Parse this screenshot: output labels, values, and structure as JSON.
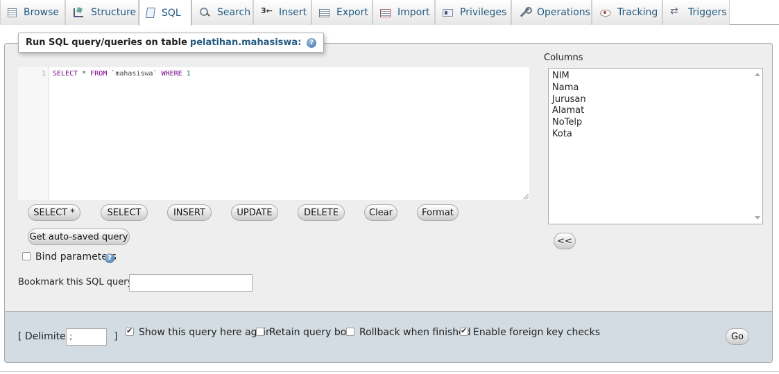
{
  "tabs": [
    {
      "label": "Browse",
      "icon": "browse-icon"
    },
    {
      "label": "Structure",
      "icon": "structure-icon"
    },
    {
      "label": "SQL",
      "icon": "sql-icon",
      "active": true
    },
    {
      "label": "Search",
      "icon": "search-icon"
    },
    {
      "label": "Insert",
      "icon": "insert-icon"
    },
    {
      "label": "Export",
      "icon": "export-icon"
    },
    {
      "label": "Import",
      "icon": "import-icon"
    },
    {
      "label": "Privileges",
      "icon": "privileges-icon"
    },
    {
      "label": "Operations",
      "icon": "operations-icon"
    },
    {
      "label": "Tracking",
      "icon": "tracking-icon"
    },
    {
      "label": "Triggers",
      "icon": "triggers-icon"
    }
  ],
  "legend": {
    "prefix": "Run SQL query/queries on table",
    "table": "pelatihan.mahasiswa:",
    "help_glyph": "?"
  },
  "editor": {
    "line_number": "1",
    "tokens": {
      "select": "SELECT",
      "star": " * ",
      "from": "FROM",
      "table": " `mahasiswa` ",
      "where": "WHERE",
      "space": " ",
      "one": "1"
    }
  },
  "buttons": {
    "select_star": "SELECT *",
    "select": "SELECT",
    "insert": "INSERT",
    "update": "UPDATE",
    "delete": "DELETE",
    "clear": "Clear",
    "format": "Format",
    "get_autosaved": "Get auto-saved query",
    "insert_column": "<<",
    "go": "Go"
  },
  "bind_parameters": {
    "label": "Bind parameters",
    "checked": false
  },
  "bookmark": {
    "label": "Bookmark this SQL query:",
    "value": ""
  },
  "columns": {
    "title": "Columns",
    "items": [
      "NIM",
      "Nama",
      "Jurusan",
      "Alamat",
      "NoTelp",
      "Kota"
    ]
  },
  "footer": {
    "delimiter_open": "[ Delimiter",
    "delimiter_value": ";",
    "delimiter_close": "]",
    "show_query_again": {
      "label": "Show this query here again",
      "checked": true
    },
    "retain_query_box": {
      "label": "Retain query box",
      "checked": false
    },
    "rollback": {
      "label": "Rollback when finished",
      "checked": false
    },
    "foreign_key_checks": {
      "label": "Enable foreign key checks",
      "checked": true
    }
  },
  "colors": {
    "link": "#235a81",
    "panel_bg": "#eeeeee",
    "footer_bg": "#d3dce3",
    "keyword": "#770088"
  }
}
